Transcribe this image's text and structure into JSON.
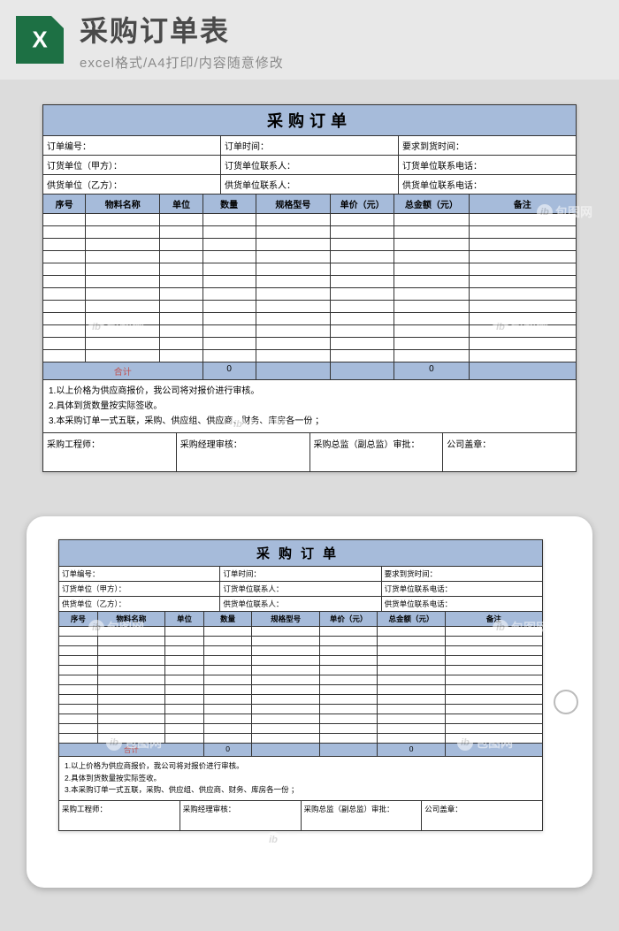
{
  "banner": {
    "title": "采购订单表",
    "subtitle": "excel格式/A4打印/内容随意修改",
    "icon_letter": "X"
  },
  "form": {
    "title": "采购订单",
    "info_rows": [
      [
        "订单编号：",
        "订单时间：",
        "要求到货时间："
      ],
      [
        "订货单位（甲方）：",
        "订货单位联系人：",
        "订货单位联系电话："
      ],
      [
        "供货单位（乙方）：",
        "供货单位联系人：",
        "供货单位联系电话："
      ]
    ]
  },
  "chart_data": {
    "type": "table",
    "columns": [
      "序号",
      "物料名称",
      "单位",
      "数量",
      "规格型号",
      "单价（元）",
      "总金额（元）",
      "备注"
    ],
    "rows": [
      [
        "",
        "",
        "",
        "",
        "",
        "",
        "",
        ""
      ],
      [
        "",
        "",
        "",
        "",
        "",
        "",
        "",
        ""
      ],
      [
        "",
        "",
        "",
        "",
        "",
        "",
        "",
        ""
      ],
      [
        "",
        "",
        "",
        "",
        "",
        "",
        "",
        ""
      ],
      [
        "",
        "",
        "",
        "",
        "",
        "",
        "",
        ""
      ],
      [
        "",
        "",
        "",
        "",
        "",
        "",
        "",
        ""
      ],
      [
        "",
        "",
        "",
        "",
        "",
        "",
        "",
        ""
      ],
      [
        "",
        "",
        "",
        "",
        "",
        "",
        "",
        ""
      ],
      [
        "",
        "",
        "",
        "",
        "",
        "",
        "",
        ""
      ],
      [
        "",
        "",
        "",
        "",
        "",
        "",
        "",
        ""
      ],
      [
        "",
        "",
        "",
        "",
        "",
        "",
        "",
        ""
      ],
      [
        "",
        "",
        "",
        "",
        "",
        "",
        "",
        ""
      ]
    ],
    "totals": {
      "label": "合计",
      "qty": "0",
      "amount": "0"
    }
  },
  "notes": [
    "1.以上价格为供应商报价，我公司将对报价进行审核。",
    "2.具体到货数量按实际签收。",
    "3.本采购订单一式五联，采购、供应组、供应商、财务、库房各一份 ；"
  ],
  "signatures": [
    "采购工程师：",
    "采购经理审核：",
    "采购总监（副总监）审批：",
    "公司盖章："
  ],
  "watermark": "包图网"
}
